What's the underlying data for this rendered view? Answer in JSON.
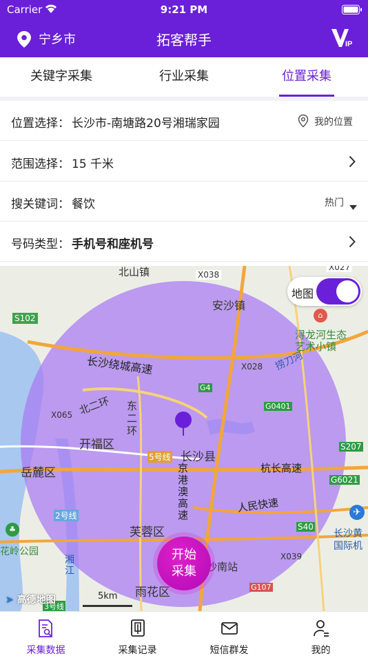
{
  "status": {
    "carrier": "Carrier",
    "time": "9:21 PM"
  },
  "nav": {
    "city": "宁乡市",
    "title": "拓客帮手",
    "vip_icon": "vip-badge-icon"
  },
  "tabs": [
    {
      "label": "关键字采集"
    },
    {
      "label": "行业采集"
    },
    {
      "label": "位置采集"
    }
  ],
  "form": {
    "location": {
      "label": "位置选择：",
      "value": "长沙市-南塘路20号湘瑞家园",
      "action": "我的位置"
    },
    "range": {
      "label": "范围选择：",
      "value": "15 千米"
    },
    "keyword": {
      "label": "搜关键词：",
      "value": "餐饮",
      "action": "热门"
    },
    "phone_type": {
      "label": "号码类型：",
      "value": "手机号和座机号"
    }
  },
  "map": {
    "toggle_label": "地图",
    "toggle_on": true,
    "labels": [
      "北山镇",
      "X038",
      "X027",
      "安沙镇",
      "S102",
      "浔龙河生态",
      "艺术小镇",
      "长沙绕城高速",
      "X028",
      "捞刀河",
      "G4",
      "北二环",
      "东二环",
      "X065",
      "G0401",
      "开福区",
      "5号线",
      "长沙县",
      "岳麓区",
      "S207",
      "杭长高速",
      "京港澳高速",
      "G6021",
      "2号线",
      "人民快速",
      "芙蓉区",
      "S40",
      "长沙黄",
      "国际机",
      "花岭公园",
      "湘江",
      "X039",
      "沙南站",
      "雨花区",
      "G107",
      "高德地图",
      "5km",
      "3号线"
    ],
    "scale": "5km",
    "logo": "高德地图"
  },
  "start_button": {
    "line1": "开始",
    "line2": "采集"
  },
  "bottom_nav": [
    {
      "label": "采集数据",
      "icon": "document-search-icon"
    },
    {
      "label": "采集记录",
      "icon": "record-book-icon"
    },
    {
      "label": "短信群发",
      "icon": "envelope-icon"
    },
    {
      "label": "我的",
      "icon": "user-icon"
    }
  ],
  "colors": {
    "brand": "#6a1fd8",
    "start": "#c010c0",
    "circle": "#a77af2"
  }
}
